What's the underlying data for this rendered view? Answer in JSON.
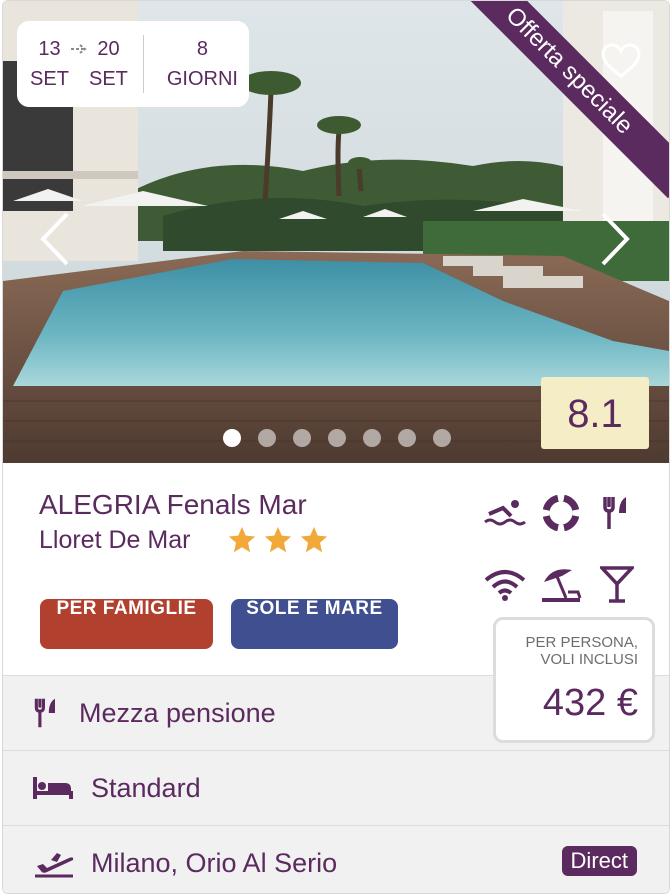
{
  "dates": {
    "start_day": "13",
    "start_month": "SET",
    "end_day": "20",
    "end_month": "SET",
    "days_count": "8",
    "days_label": "GIORNI"
  },
  "offer_ribbon": "Offerta speciale",
  "score": "8.1",
  "carousel": {
    "slides": 7,
    "active": 1
  },
  "hotel": {
    "name": "ALEGRIA Fenals Mar",
    "location": "Lloret De Mar",
    "stars": 3,
    "star_color": "#f3a93a"
  },
  "amenities": [
    "swimming-icon",
    "lifebuoy-icon",
    "restaurant-icon",
    "wifi-icon",
    "beach-umbrella-icon",
    "cocktail-icon"
  ],
  "tags": [
    {
      "label": "PER FAMIGLIE",
      "color": "#b2402e"
    },
    {
      "label": "SOLE E MARE",
      "color": "#3f4f90"
    }
  ],
  "price": {
    "label_line1": "PER PERSONA,",
    "label_line2": "VOLI INCLUSI",
    "amount": "432 €"
  },
  "details": {
    "board": "Mezza pensione",
    "room": "Standard",
    "airport": "Milano, Orio Al Serio",
    "flight_type": "Direct"
  },
  "colors": {
    "brand": "#5b2a5f",
    "score_bg": "#f5edc5"
  }
}
